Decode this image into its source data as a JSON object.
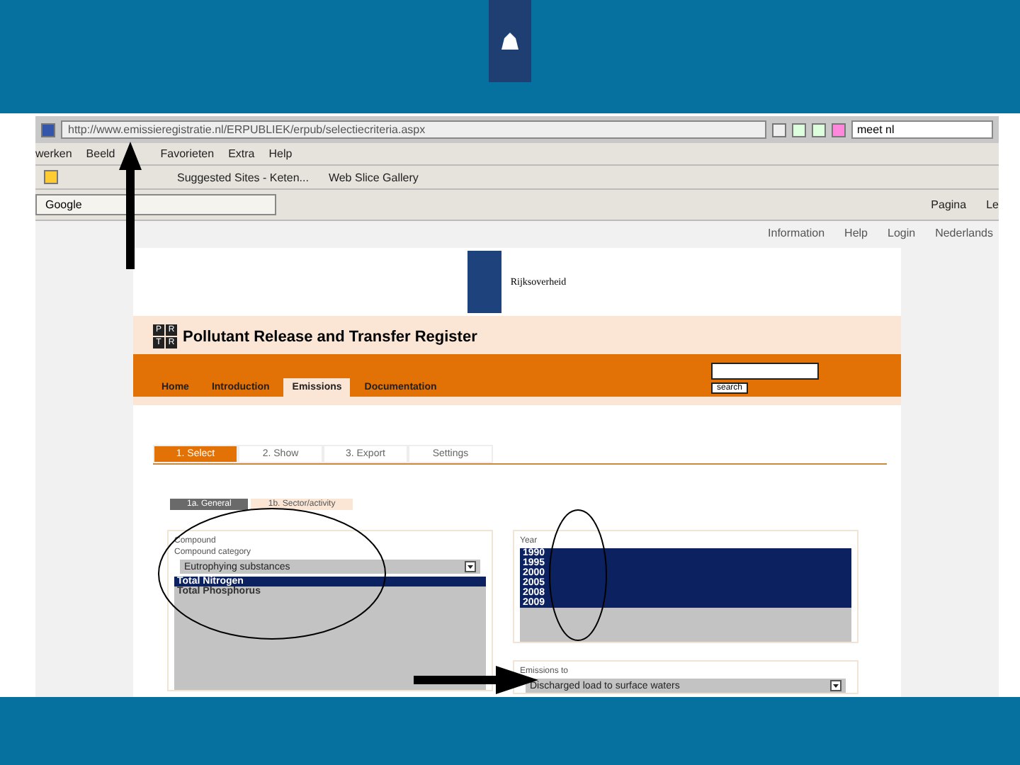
{
  "browser": {
    "address": "http://www.emissieregistratie.nl/ERPUBLIEK/erpub/selectiecriteria.aspx",
    "search": "meet nl",
    "menu": [
      "werken",
      "Beeld",
      "Favorieten",
      "Extra",
      "Help"
    ],
    "favorites": [
      "Suggested Sites - Keten...",
      "Web Slice Gallery"
    ],
    "tab": "Google",
    "tools": [
      "Pagina",
      "Le"
    ]
  },
  "page": {
    "top_links": [
      "Information",
      "Help",
      "Login",
      "Nederlands"
    ],
    "brand": "Rijksoverheid",
    "logo_letters": [
      "P",
      "R",
      "T",
      "R"
    ],
    "title": "Pollutant Release and Transfer Register",
    "nav": [
      {
        "label": "Home",
        "selected": false
      },
      {
        "label": "Introduction",
        "selected": false
      },
      {
        "label": "Emissions",
        "selected": true
      },
      {
        "label": "Documentation",
        "selected": false
      }
    ],
    "search_button": "search",
    "steps": [
      {
        "label": "1. Select",
        "selected": true
      },
      {
        "label": "2. Show",
        "selected": false
      },
      {
        "label": "3. Export",
        "selected": false
      },
      {
        "label": "Settings",
        "selected": false
      }
    ],
    "subtabs": [
      {
        "label": "1a. General",
        "selected": true
      },
      {
        "label": "1b. Sector/activity",
        "selected": false
      }
    ],
    "compound": {
      "legend": "Compound",
      "label": "Compound category",
      "value": "Eutrophying substances",
      "options": [
        {
          "label": "Total Nitrogen",
          "selected": true
        },
        {
          "label": "Total Phosphorus",
          "selected": false
        }
      ]
    },
    "year": {
      "legend": "Year",
      "options": [
        {
          "label": "1990",
          "selected": true
        },
        {
          "label": "1995",
          "selected": true
        },
        {
          "label": "2000",
          "selected": true
        },
        {
          "label": "2005",
          "selected": true
        },
        {
          "label": "2008",
          "selected": true
        },
        {
          "label": "2009",
          "selected": true
        }
      ]
    },
    "emission": {
      "legend": "Emissions to",
      "value": "Discharged load to surface waters"
    }
  }
}
